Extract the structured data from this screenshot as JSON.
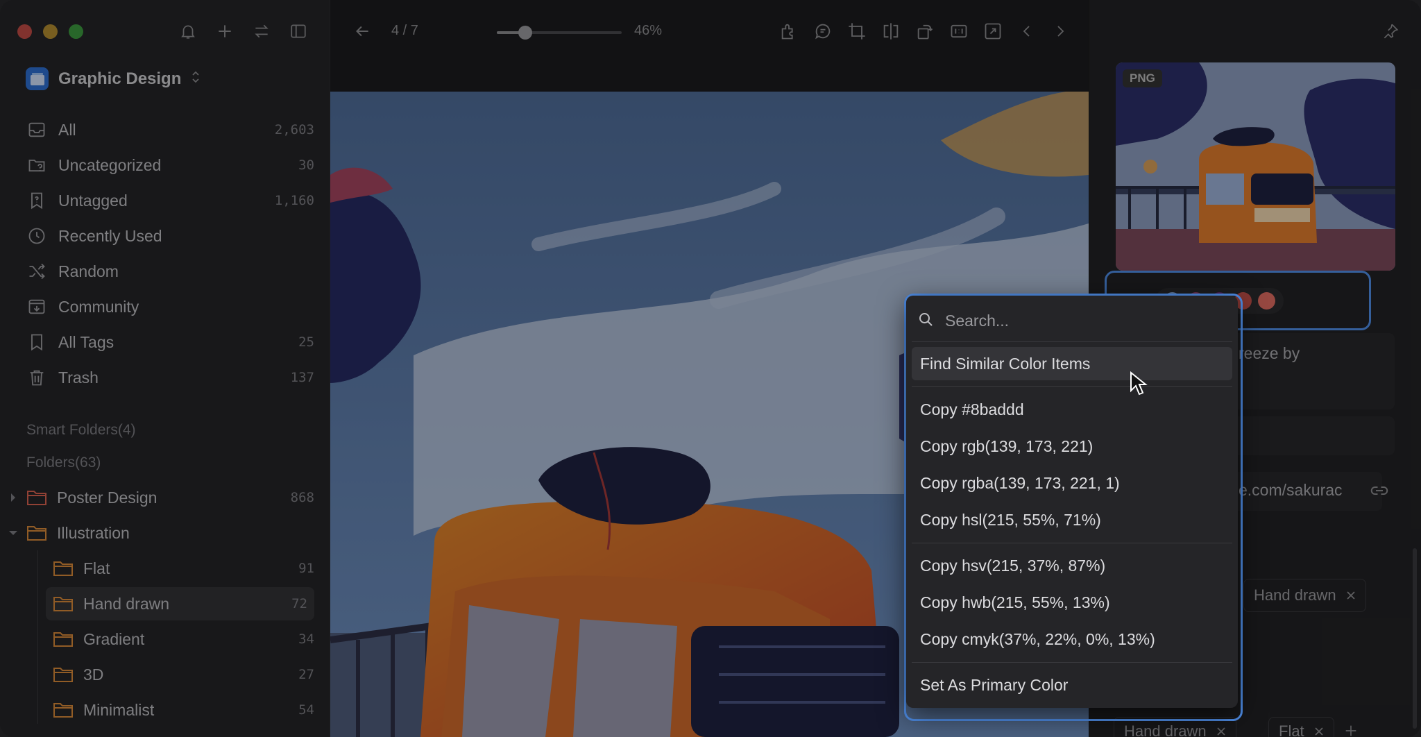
{
  "sidebar": {
    "library_name": "Graphic Design",
    "nav": [
      {
        "label": "All",
        "count": "2,603",
        "icon": "inbox-icon"
      },
      {
        "label": "Uncategorized",
        "count": "30",
        "icon": "folder-question-icon"
      },
      {
        "label": "Untagged",
        "count": "1,160",
        "icon": "tag-question-icon"
      },
      {
        "label": "Recently Used",
        "count": "",
        "icon": "clock-icon"
      },
      {
        "label": "Random",
        "count": "",
        "icon": "shuffle-icon"
      },
      {
        "label": "Community",
        "count": "",
        "icon": "download-box-icon"
      },
      {
        "label": "All Tags",
        "count": "25",
        "icon": "bookmark-icon"
      },
      {
        "label": "Trash",
        "count": "137",
        "icon": "trash-icon"
      }
    ],
    "smart_folders_label": "Smart Folders(4)",
    "folders_label": "Folders(63)",
    "folders": [
      {
        "label": "Poster Design",
        "count": "868"
      },
      {
        "label": "Illustration",
        "count": ""
      }
    ],
    "subfolders": [
      {
        "label": "Flat",
        "count": "91"
      },
      {
        "label": "Hand drawn",
        "count": "72"
      },
      {
        "label": "Gradient",
        "count": "34"
      },
      {
        "label": "3D",
        "count": "27"
      },
      {
        "label": "Minimalist",
        "count": "54"
      }
    ]
  },
  "toolbar": {
    "pager": "4 / 7",
    "zoom_percent": 46,
    "zoom_label": "46%"
  },
  "right_panel": {
    "format_badge": "PNG",
    "palette": [
      "#8baddd",
      "#a04670",
      "#6d2f7a",
      "#c2504a",
      "#e06c61"
    ],
    "note_fragment": "reeze by",
    "url_fragment": "e.com/sakurac",
    "tag_visible": "Hand drawn",
    "bottom_tags": [
      "Hand drawn",
      "Flat"
    ]
  },
  "context_menu": {
    "search_placeholder": "Search...",
    "find_similar": "Find Similar Color Items",
    "copy_items": [
      "Copy #8baddd",
      "Copy rgb(139, 173, 221)",
      "Copy rgba(139, 173, 221, 1)",
      "Copy hsl(215, 55%, 71%)"
    ],
    "copy_items_2": [
      "Copy hsv(215, 37%, 87%)",
      "Copy hwb(215, 55%, 13%)",
      "Copy cmyk(37%, 22%, 0%, 13%)"
    ],
    "set_primary": "Set As Primary Color"
  },
  "colors": {
    "accent": "#4f8ee8",
    "folder": "#d9624f"
  }
}
